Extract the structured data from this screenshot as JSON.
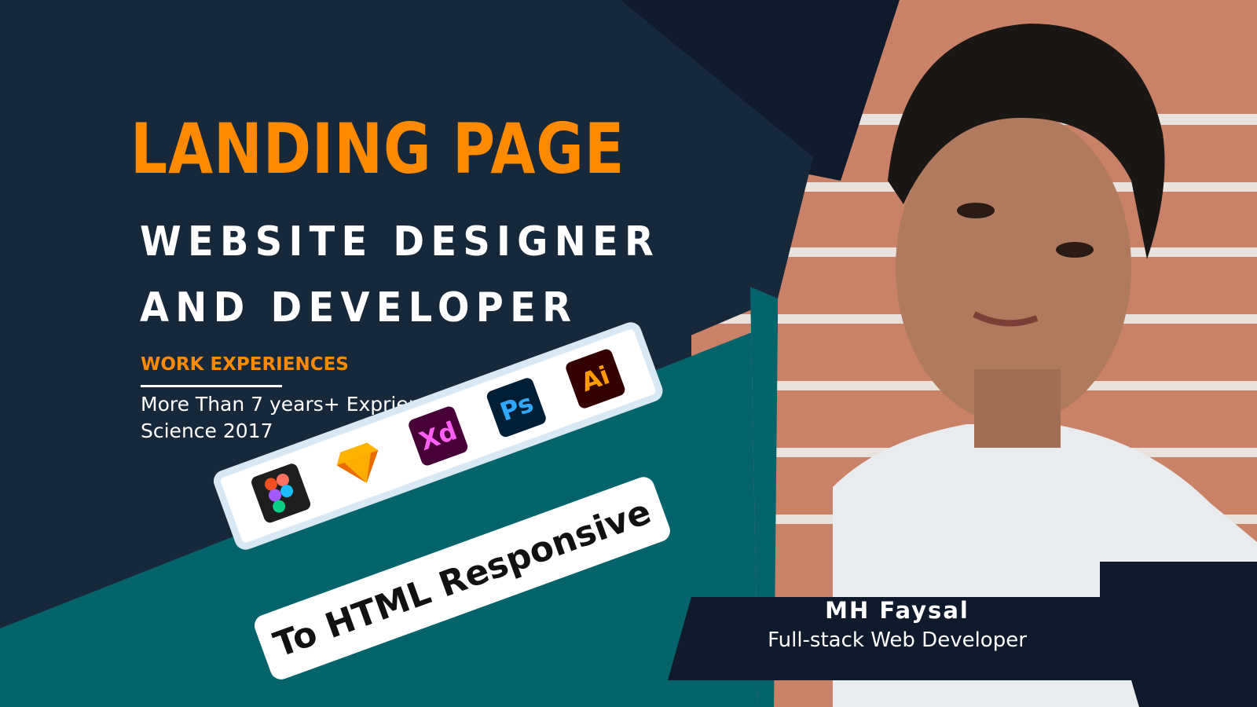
{
  "colors": {
    "navy": "#17283a",
    "dark_navy": "#0f1a2c",
    "teal": "#05646b",
    "orange": "#ff8a00",
    "white": "#ffffff",
    "brick": "#c98268"
  },
  "hero": {
    "headline": "LANDING PAGE",
    "subhead": "WEBSITE DESIGNER AND DEVELOPER"
  },
  "work": {
    "title": "WORK EXPERIENCES",
    "line1": "More Than 7 years+ Exprienсes",
    "line2": "Science 2017"
  },
  "tools": [
    {
      "name": "figma-icon",
      "label": ""
    },
    {
      "name": "sketch-icon",
      "label": ""
    },
    {
      "name": "xd-icon",
      "label": "Xd"
    },
    {
      "name": "ps-icon",
      "label": "Ps"
    },
    {
      "name": "ai-icon",
      "label": "Ai"
    }
  ],
  "cta": "To HTML Responsive",
  "person": {
    "name": "MH Faysal",
    "role": "Full-stack Web Developer"
  }
}
